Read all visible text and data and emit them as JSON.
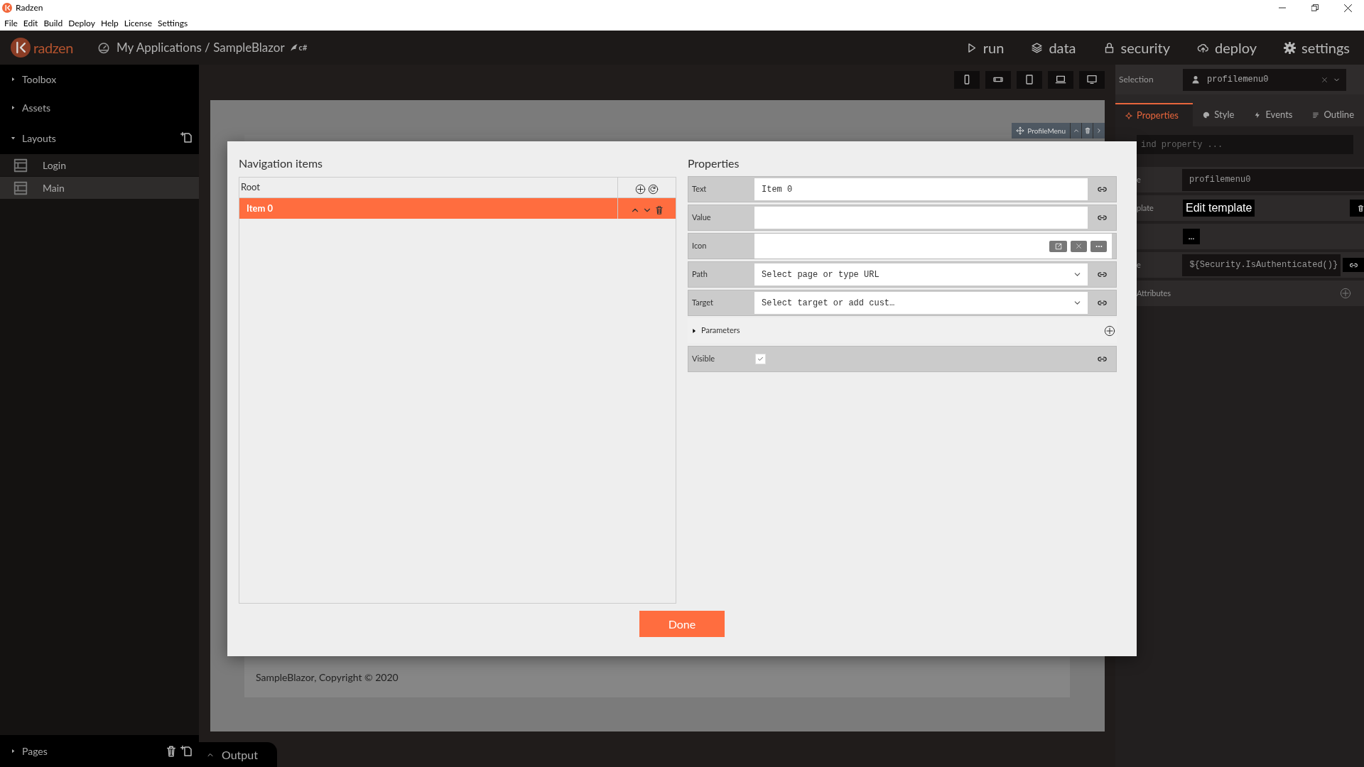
{
  "window": {
    "title": "Radzen"
  },
  "menu": [
    "File",
    "Edit",
    "Build",
    "Deploy",
    "Help",
    "License",
    "Settings"
  ],
  "header": {
    "logo": "radzen",
    "breadcrumb": "My Applications / SampleBlazor",
    "framework": "c#",
    "nav": [
      {
        "label": "run",
        "kind": "run"
      },
      {
        "label": "data",
        "kind": "data"
      },
      {
        "label": "security",
        "kind": "security"
      },
      {
        "label": "deploy",
        "kind": "deploy"
      },
      {
        "label": "settings",
        "kind": "settings"
      }
    ]
  },
  "sidebar": {
    "sections": [
      {
        "label": "Toolbox",
        "expanded": false
      },
      {
        "label": "Assets",
        "expanded": false
      },
      {
        "label": "Layouts",
        "expanded": true,
        "items": [
          {
            "label": "Login",
            "selected": false
          },
          {
            "label": "Main",
            "selected": true
          }
        ]
      }
    ],
    "footer": {
      "label": "Pages",
      "expanded": false
    }
  },
  "canvas": {
    "component_toolbar": "ProfileMenu",
    "footer": "SampleBlazor, Copyright © 2020"
  },
  "output_tab": {
    "label": "Output",
    "expanded": false
  },
  "inspector": {
    "selection_label": "Selection",
    "selection_value": "profilemenu0",
    "tabs": [
      {
        "label": "Properties",
        "selected": true,
        "kind": "properties"
      },
      {
        "label": "Style",
        "selected": false,
        "kind": "style"
      },
      {
        "label": "Events",
        "selected": false,
        "kind": "events"
      },
      {
        "label": "Outline",
        "selected": false,
        "kind": "outline"
      }
    ],
    "search_placeholder": "ind property ...",
    "rows": [
      {
        "label": "e",
        "kind": "text",
        "value": "profilemenu0"
      },
      {
        "label": "plate",
        "kind": "template",
        "value": "Edit template"
      },
      {
        "kind": "ellipsis",
        "value": "..."
      },
      {
        "label": "e",
        "kind": "expression",
        "value": "${Security.IsAuthenticated()}"
      },
      {
        "label": "Attributes",
        "kind": "add"
      }
    ]
  },
  "dialog": {
    "tree_title": "Navigation items",
    "tree": {
      "label": "Root",
      "selected": false,
      "children": [
        {
          "label": "Item 0",
          "selected": true
        }
      ]
    },
    "properties_title": "Properties",
    "fields": [
      {
        "label": "Text",
        "kind": "text",
        "value": "Item 0"
      },
      {
        "label": "Value",
        "kind": "text"
      },
      {
        "label": "Icon",
        "kind": "icon"
      },
      {
        "label": "Path",
        "kind": "dropdown",
        "placeholder": "Select page or type URL"
      },
      {
        "label": "Target",
        "kind": "dropdown",
        "placeholder": "Select target or add cust…"
      },
      {
        "label": "Parameters",
        "kind": "section",
        "expanded": false
      },
      {
        "label": "Visible",
        "kind": "checkbox",
        "checked": true
      }
    ],
    "done": "Done"
  }
}
